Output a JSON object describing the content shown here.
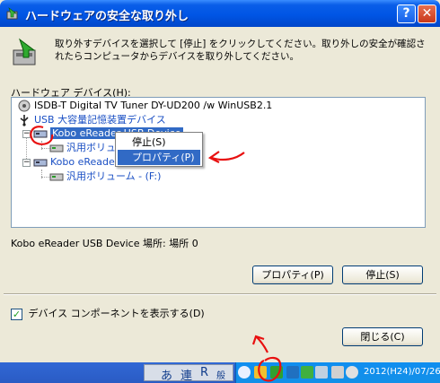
{
  "window": {
    "title": "ハードウェアの安全な取り外し",
    "help_label": "?",
    "close_label": "✕"
  },
  "instruction": "取り外すデバイスを選択して [停止] をクリックしてください。取り外しの安全が確認されたらコンピュータからデバイスを取り外してください。",
  "hardware_label": "ハードウェア デバイス(H):",
  "tree": {
    "items": [
      {
        "label": "ISDB-T Digital TV Tuner DY-UD200 /w WinUSB2.1"
      },
      {
        "label": "USB 大容量記憶装置デバイス"
      },
      {
        "label": "Kobo eReader USB Device"
      },
      {
        "label": "汎用ボリュ"
      },
      {
        "label": "Kobo eReader"
      },
      {
        "label": "汎用ボリューム - (F:)"
      }
    ]
  },
  "context_menu": {
    "items": [
      {
        "label": "停止(S)"
      },
      {
        "label": "プロパティ(P)"
      }
    ]
  },
  "device_location": "Kobo eReader USB Device 場所: 場所 0",
  "buttons": {
    "properties": "プロパティ(P)",
    "stop": "停止(S)",
    "close": "閉じる(C)"
  },
  "checkbox": {
    "label": "デバイス コンポーネントを表示する(D)",
    "checked": true,
    "mark": "✓"
  },
  "taskbar": {
    "ime": [
      "あ",
      "連",
      "R",
      "般"
    ],
    "clock": "2012(H24)/07/26"
  },
  "colors": {
    "annotation": "#e81010",
    "selection": "#316ac5",
    "title_bar": "#0055e5"
  }
}
